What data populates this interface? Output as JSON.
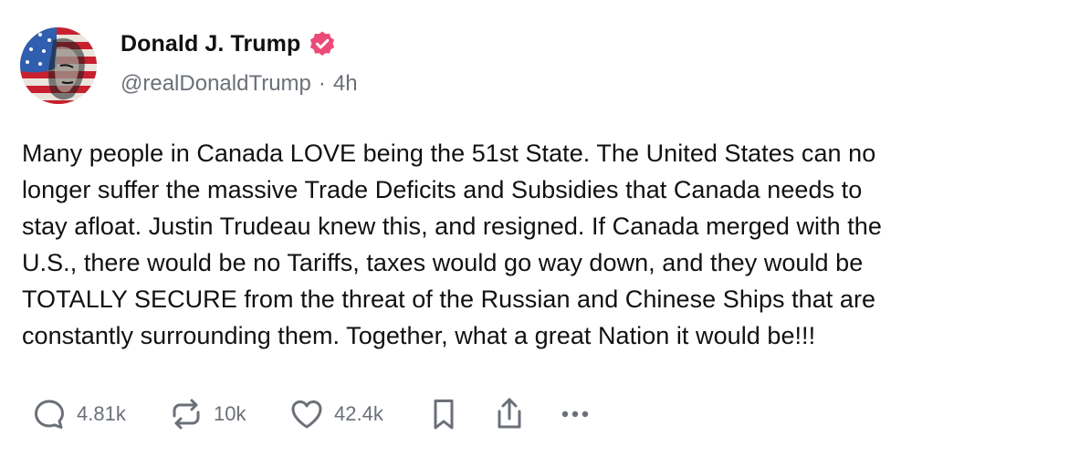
{
  "author": {
    "display_name": "Donald J. Trump",
    "handle": "@realDonaldTrump",
    "separator": "·",
    "time_ago": "4h",
    "verified_color": "#ec4a78",
    "avatar_icon": "flag-portrait-avatar"
  },
  "post": {
    "text": "Many people in Canada LOVE being the 51st State. The United States can no\nlonger suffer the massive Trade Deficits and Subsidies that Canada needs to\nstay afloat. Justin Trudeau knew this, and resigned. If Canada merged with the\nU.S., there would be no Tariffs, taxes would go way down, and they would be\nTOTALLY SECURE from the threat of the Russian and Chinese Ships that are\nconstantly surrounding them. Together, what a great Nation it would be!!!"
  },
  "actions": {
    "replies": "4.81k",
    "reposts": "10k",
    "likes": "42.4k",
    "icons": [
      "reply-icon",
      "repost-icon",
      "like-icon",
      "bookmark-icon",
      "share-icon",
      "more-icon"
    ]
  },
  "colors": {
    "text": "#111111",
    "muted": "#6b7078",
    "background": "#ffffff"
  }
}
